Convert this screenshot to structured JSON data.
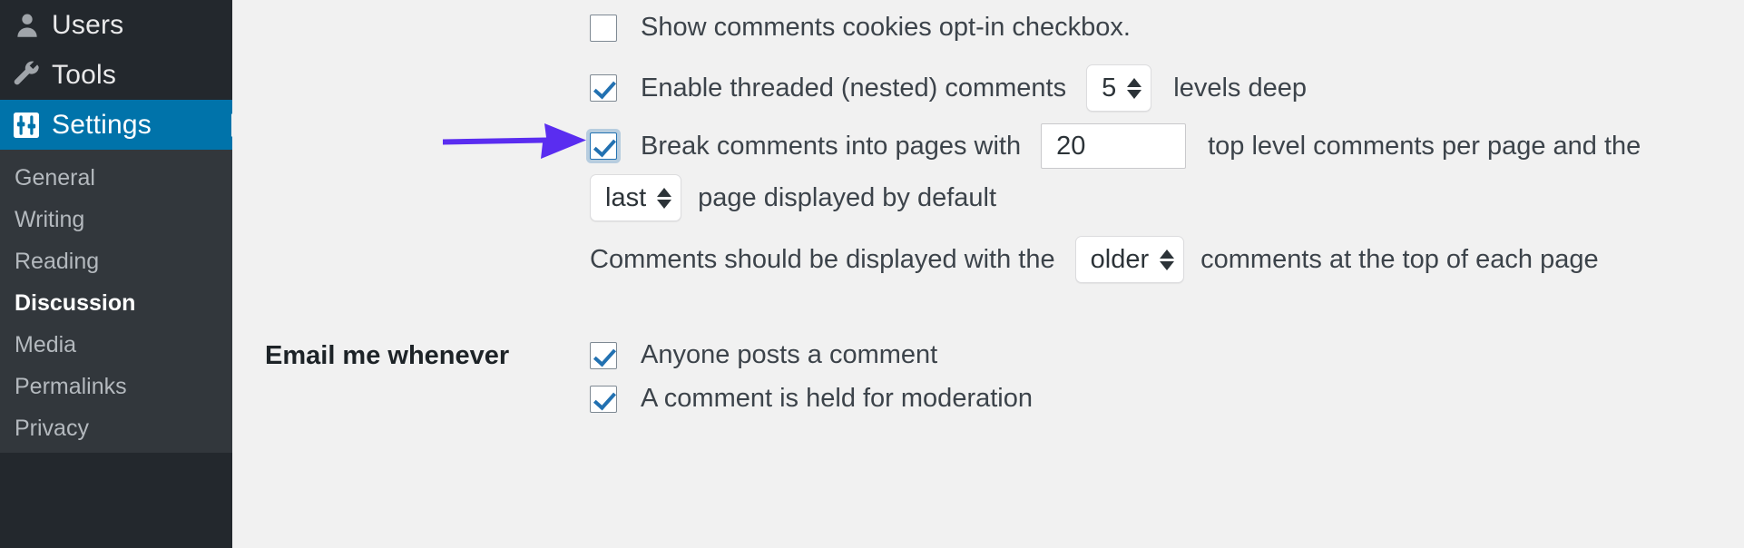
{
  "sidebar": {
    "top_items": [
      {
        "label": "Users",
        "icon": "users-icon",
        "active": false
      },
      {
        "label": "Tools",
        "icon": "wrench-icon",
        "active": false
      },
      {
        "label": "Settings",
        "icon": "settings-sliders-icon",
        "active": true
      }
    ],
    "submenu_items": [
      {
        "label": "General",
        "current": false
      },
      {
        "label": "Writing",
        "current": false
      },
      {
        "label": "Reading",
        "current": false
      },
      {
        "label": "Discussion",
        "current": true
      },
      {
        "label": "Media",
        "current": false
      },
      {
        "label": "Permalinks",
        "current": false
      },
      {
        "label": "Privacy",
        "current": false
      }
    ]
  },
  "colors": {
    "sidebar_bg": "#23282d",
    "submenu_bg": "#32373c",
    "active_blue": "#0073aa",
    "content_bg": "#f1f1f1",
    "checkbox_check": "#2271b1",
    "annotation_arrow": "#5a2df0"
  },
  "settings": {
    "cookies_optin": {
      "label": "Show comments cookies opt-in checkbox.",
      "checked": false
    },
    "threaded": {
      "label": "Enable threaded (nested) comments",
      "checked": true,
      "levels_value": "5",
      "levels_suffix": "levels deep"
    },
    "break_pages": {
      "label": "Break comments into pages with",
      "checked": true,
      "focused": true,
      "per_page_value": "20",
      "suffix": "top level comments per page and the",
      "default_page_value": "last",
      "default_page_suffix": "page displayed by default"
    },
    "display_order": {
      "prefix": "Comments should be displayed with the",
      "value": "older",
      "suffix": "comments at the top of each page"
    }
  },
  "email_section": {
    "title": "Email me whenever",
    "options": [
      {
        "label": "Anyone posts a comment",
        "checked": true
      },
      {
        "label": "A comment is held for moderation",
        "checked": true
      }
    ]
  }
}
